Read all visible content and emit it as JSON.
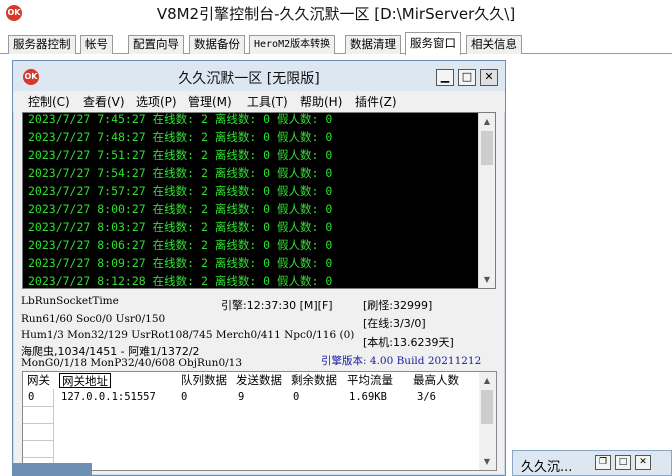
{
  "window": {
    "title": "V8M2引擎控制台-久久沉默一区 [D:\\MirServer久久\\]",
    "icon": "app-icon"
  },
  "tabs": [
    {
      "label": "服务器控制"
    },
    {
      "label": "帐号"
    },
    {
      "label": "配置向导"
    },
    {
      "label": "数据备份"
    },
    {
      "label": "HeroM2版本转换"
    },
    {
      "label": "数据清理"
    },
    {
      "label": "服务窗口",
      "active": true
    },
    {
      "label": "相关信息"
    }
  ],
  "inner": {
    "title": "久久沉默一区 [无限版]",
    "menu": [
      "控制(C)",
      "查看(V)",
      "选项(P)",
      "管理(M)",
      "工具(T)",
      "帮助(H)",
      "插件(Z)"
    ],
    "log_lines": [
      "2023/7/27 7:45:27 在线数: 2 离线数: 0 假人数: 0",
      "2023/7/27 7:48:27 在线数: 2 离线数: 0 假人数: 0",
      "2023/7/27 7:51:27 在线数: 2 离线数: 0 假人数: 0",
      "2023/7/27 7:54:27 在线数: 2 离线数: 0 假人数: 0",
      "2023/7/27 7:57:27 在线数: 2 离线数: 0 假人数: 0",
      "2023/7/27 8:00:27 在线数: 2 离线数: 0 假人数: 0",
      "2023/7/27 8:03:27 在线数: 2 离线数: 0 假人数: 0",
      "2023/7/27 8:06:27 在线数: 2 离线数: 0 假人数: 0",
      "2023/7/27 8:09:27 在线数: 2 离线数: 0 假人数: 0",
      "2023/7/27 8:12:28 在线数: 2 离线数: 0 假人数: 0"
    ],
    "stats": {
      "run_socket_time": "LbRunSocketTime",
      "engine": "引擎:12:37:30 [M][F]",
      "refresh": "[刷怪:32999]",
      "run": "Run61/60 Soc0/0 Usr0/150",
      "online": "[在线:3/3/0]",
      "hum": "Hum1/3 Mon32/129 UsrRot108/745 Merch0/411 Npc0/116 (0)",
      "pirate": "海爬虫,1034/1451 - 阿难1/1372/2",
      "machine": "[本机:13.6239天]",
      "mon": "MonG0/1/18 MonP32/40/608 ObjRun0/13",
      "version": "引擎版本: 4.00 Build 20211212"
    },
    "grid": {
      "headers": [
        "网关",
        "网关地址",
        "队列数据",
        "发送数据",
        "剩余数据",
        "平均流量",
        "最高人数"
      ],
      "rows": [
        [
          "0",
          "127.0.0.1:51557",
          "0",
          "9",
          "0",
          "1.69KB",
          "3/6"
        ]
      ]
    }
  },
  "taskbar": {
    "label": "久久沉..."
  }
}
